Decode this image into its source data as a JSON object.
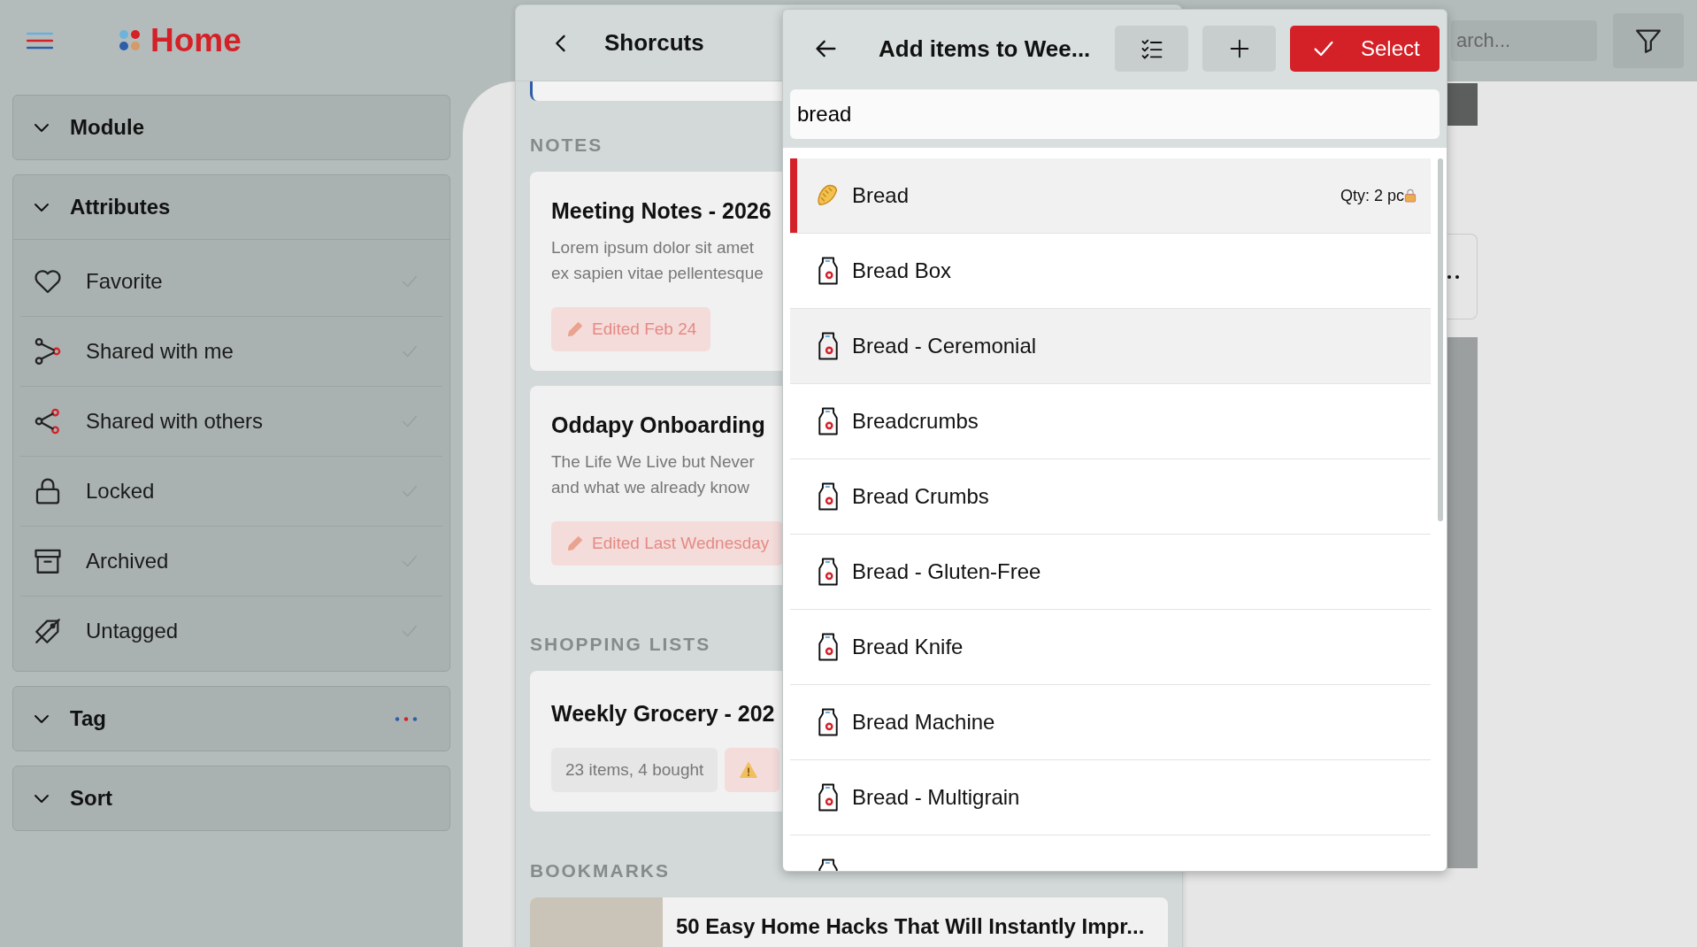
{
  "header": {
    "title": "Home",
    "search_placeholder": "arch..."
  },
  "sidebar": {
    "sections": [
      {
        "title": "Module"
      },
      {
        "title": "Attributes",
        "items": [
          {
            "label": "Favorite",
            "kind": "heart",
            "checked": false
          },
          {
            "label": "Shared with me",
            "kind": "received",
            "checked": false
          },
          {
            "label": "Shared with others",
            "kind": "share",
            "checked": false
          },
          {
            "label": "Locked",
            "kind": "lock",
            "checked": false
          },
          {
            "label": "Archived",
            "kind": "archive",
            "checked": false
          },
          {
            "label": "Untagged",
            "kind": "untagged",
            "checked": false
          }
        ]
      },
      {
        "title": "Tag",
        "more": true
      },
      {
        "title": "Sort"
      }
    ]
  },
  "shortcuts": {
    "title": "Shorcuts",
    "sections": [
      {
        "heading": "NOTES",
        "kind": "notes",
        "cards": [
          {
            "title": "Meeting Notes - 2026",
            "lines": [
              "Lorem ipsum dolor sit amet",
              "ex sapien vitae pellentesque"
            ],
            "chips": [
              {
                "kind": "edited",
                "text": "Edited Feb 24"
              }
            ]
          },
          {
            "title": "Oddapy Onboarding",
            "lines": [
              "The Life We Live but Never",
              "and what we already know"
            ],
            "chips": [
              {
                "kind": "edited",
                "text": "Edited Last Wednesday"
              }
            ]
          }
        ]
      },
      {
        "heading": "SHOPPING LISTS",
        "kind": "lists",
        "cards": [
          {
            "title": "Weekly Grocery - 202",
            "chips": [
              {
                "kind": "count",
                "text": "23 items, 4 bought"
              },
              {
                "kind": "warning"
              }
            ]
          }
        ]
      },
      {
        "heading": "BOOKMARKS",
        "kind": "bookmarks",
        "cards": [
          {
            "title": "50 Easy Home Hacks That Will Instantly Impr..."
          }
        ]
      }
    ]
  },
  "picker": {
    "title": "Add items to Wee...",
    "select_label": "Select",
    "search_value": "bread",
    "items": [
      {
        "kind": "bread",
        "name": "Bread",
        "qty": "Qty: 2 pc",
        "locked": true,
        "selected": true,
        "highlighted": true
      },
      {
        "kind": "package",
        "name": "Bread Box",
        "selected": false,
        "highlighted": false
      },
      {
        "kind": "package",
        "name": "Bread - Ceremonial",
        "selected": false,
        "highlighted": true
      },
      {
        "kind": "package",
        "name": "Breadcrumbs",
        "selected": false,
        "highlighted": false
      },
      {
        "kind": "package",
        "name": "Bread Crumbs",
        "selected": false,
        "highlighted": false
      },
      {
        "kind": "package",
        "name": "Bread - Gluten-Free",
        "selected": false,
        "highlighted": false
      },
      {
        "kind": "package",
        "name": "Bread Knife",
        "selected": false,
        "highlighted": false
      },
      {
        "kind": "package",
        "name": "Bread Machine",
        "selected": false,
        "highlighted": false
      },
      {
        "kind": "package",
        "name": "Bread - Multigrain",
        "selected": false,
        "highlighted": false
      },
      {
        "kind": "package",
        "selected": false,
        "highlighted": false
      }
    ]
  }
}
